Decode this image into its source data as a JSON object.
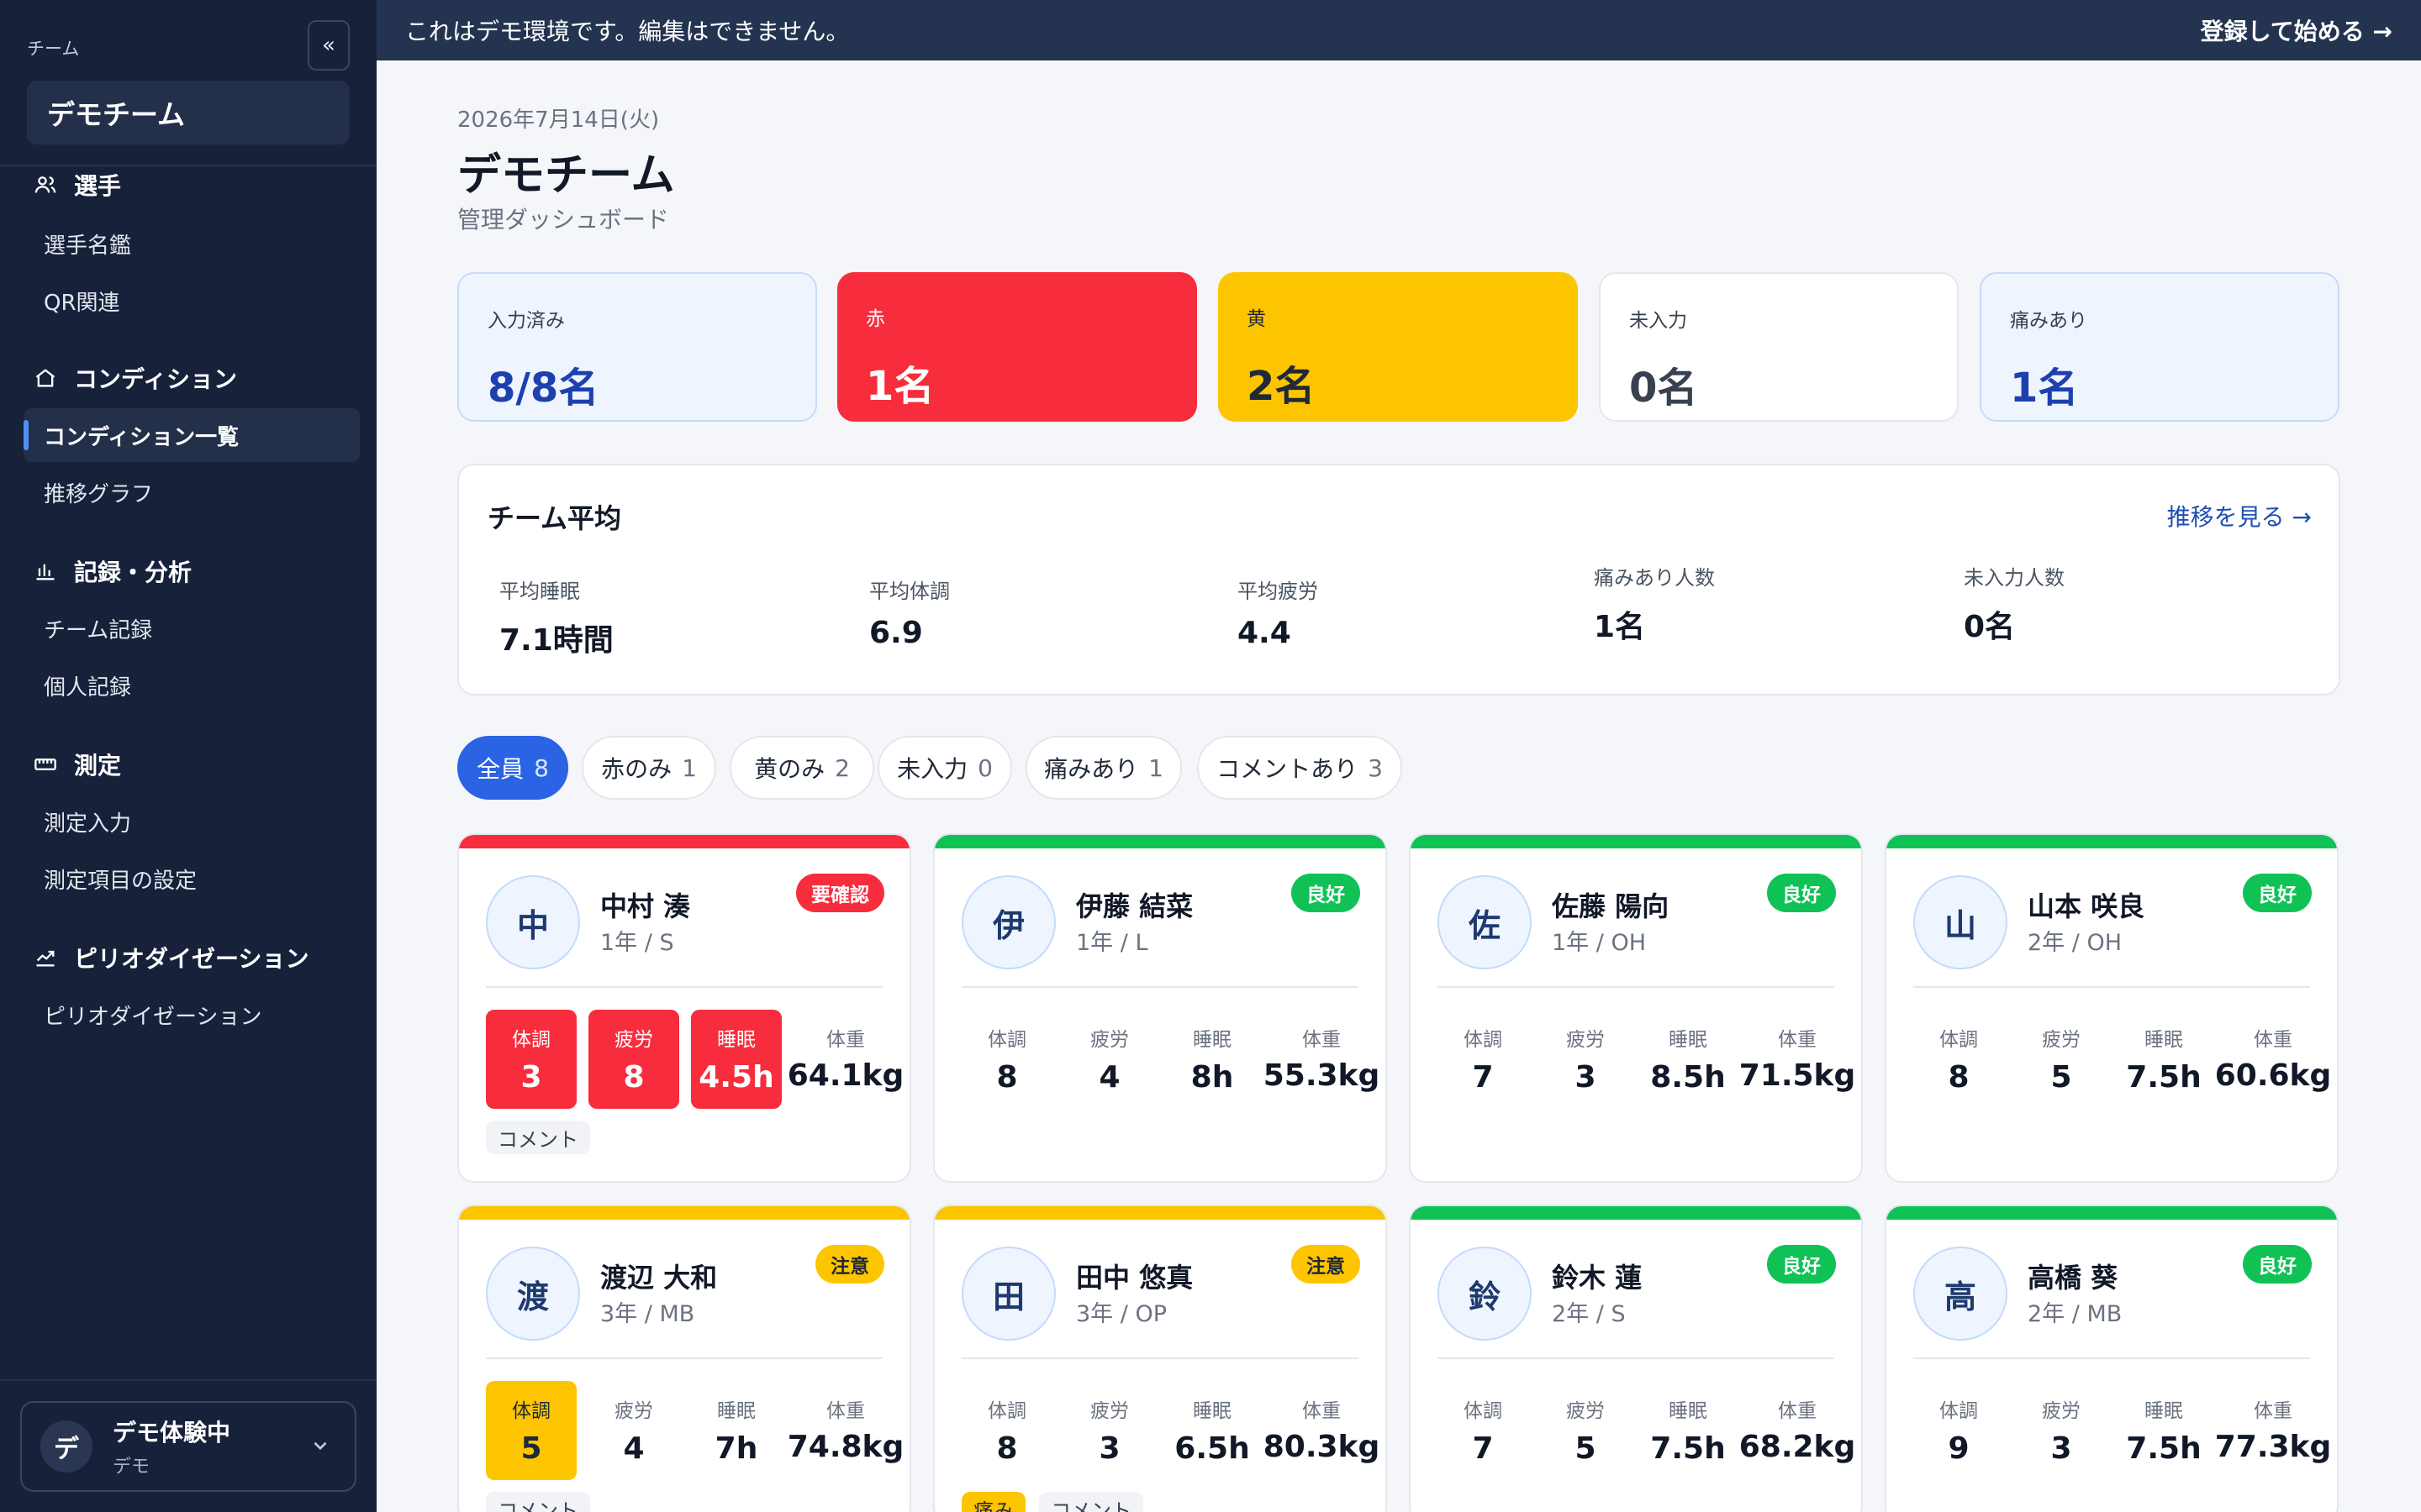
{
  "sidebar": {
    "team_caption": "チーム",
    "team_name": "デモチーム",
    "collapse_label": "«",
    "sections": [
      {
        "label": "選手",
        "icon": "users-icon",
        "items": [
          {
            "label": "選手名鑑",
            "active": false
          },
          {
            "label": "QR関連",
            "active": false
          }
        ]
      },
      {
        "label": "コンディション",
        "icon": "home-icon",
        "items": [
          {
            "label": "コンディション一覧",
            "active": true
          },
          {
            "label": "推移グラフ",
            "active": false
          }
        ]
      },
      {
        "label": "記録・分析",
        "icon": "bar-chart-icon",
        "items": [
          {
            "label": "チーム記録",
            "active": false
          },
          {
            "label": "個人記録",
            "active": false
          }
        ]
      },
      {
        "label": "測定",
        "icon": "ruler-icon",
        "items": [
          {
            "label": "測定入力",
            "active": false
          },
          {
            "label": "測定項目の設定",
            "active": false
          }
        ]
      },
      {
        "label": "ピリオダイゼーション",
        "icon": "trend-icon",
        "items": [
          {
            "label": "ピリオダイゼーション",
            "active": false
          }
        ]
      }
    ],
    "user": {
      "avatar": "デ",
      "name": "デモ体験中",
      "sub": "デモ"
    }
  },
  "banner": {
    "message": "これはデモ環境です。編集はできません。",
    "cta": "登録して始める →"
  },
  "header": {
    "date": "2026年7月14日(火)",
    "title": "デモチーム",
    "subtitle": "管理ダッシュボード"
  },
  "stats": [
    {
      "label": "入力済み",
      "value": "8/8名",
      "style": "blue"
    },
    {
      "label": "赤",
      "value": "1名",
      "style": "red"
    },
    {
      "label": "黄",
      "value": "2名",
      "style": "yellow"
    },
    {
      "label": "未入力",
      "value": "0名",
      "style": "white"
    },
    {
      "label": "痛みあり",
      "value": "1名",
      "style": "blue"
    }
  ],
  "team_average": {
    "title": "チーム平均",
    "link": "推移を見る →",
    "metrics": [
      {
        "label": "平均睡眠",
        "value": "7.1時間"
      },
      {
        "label": "平均体調",
        "value": "6.9"
      },
      {
        "label": "平均疲労",
        "value": "4.4"
      },
      {
        "label": "痛みあり人数",
        "value": "1名"
      },
      {
        "label": "未入力人数",
        "value": "0名"
      }
    ]
  },
  "filters": [
    {
      "label": "全員",
      "count": "8",
      "active": true
    },
    {
      "label": "赤のみ",
      "count": "1",
      "active": false
    },
    {
      "label": "黄のみ",
      "count": "2",
      "active": false
    },
    {
      "label": "未入力",
      "count": "0",
      "active": false
    },
    {
      "label": "痛みあり",
      "count": "1",
      "active": false
    },
    {
      "label": "コメントあり",
      "count": "3",
      "active": false
    }
  ],
  "colors": {
    "red": "#f72c3c",
    "yellow": "#fdc500",
    "green": "#10c255",
    "accent": "#2a63e3"
  },
  "metric_labels": {
    "condition": "体調",
    "fatigue": "疲労",
    "sleep": "睡眠",
    "weight": "体重"
  },
  "players": [
    {
      "initial": "中",
      "name": "中村 湊",
      "meta": "1年 / S",
      "status": "要確認",
      "status_color": "red",
      "condition": "3",
      "fatigue": "8",
      "sleep": "4.5h",
      "weight": "64.1kg",
      "highlight": {
        "condition": "red",
        "fatigue": "red",
        "sleep": "red"
      },
      "tags": [
        "コメント"
      ]
    },
    {
      "initial": "伊",
      "name": "伊藤 結菜",
      "meta": "1年 / L",
      "status": "良好",
      "status_color": "green",
      "condition": "8",
      "fatigue": "4",
      "sleep": "8h",
      "weight": "55.3kg",
      "highlight": {},
      "tags": []
    },
    {
      "initial": "佐",
      "name": "佐藤 陽向",
      "meta": "1年 / OH",
      "status": "良好",
      "status_color": "green",
      "condition": "7",
      "fatigue": "3",
      "sleep": "8.5h",
      "weight": "71.5kg",
      "highlight": {},
      "tags": []
    },
    {
      "initial": "山",
      "name": "山本 咲良",
      "meta": "2年 / OH",
      "status": "良好",
      "status_color": "green",
      "condition": "8",
      "fatigue": "5",
      "sleep": "7.5h",
      "weight": "60.6kg",
      "highlight": {},
      "tags": []
    },
    {
      "initial": "渡",
      "name": "渡辺 大和",
      "meta": "3年 / MB",
      "status": "注意",
      "status_color": "yellow",
      "condition": "5",
      "fatigue": "4",
      "sleep": "7h",
      "weight": "74.8kg",
      "highlight": {
        "condition": "yellow"
      },
      "tags": [
        "コメント"
      ]
    },
    {
      "initial": "田",
      "name": "田中 悠真",
      "meta": "3年 / OP",
      "status": "注意",
      "status_color": "yellow",
      "condition": "8",
      "fatigue": "3",
      "sleep": "6.5h",
      "weight": "80.3kg",
      "highlight": {},
      "tags": [
        "痛み",
        "コメント"
      ]
    },
    {
      "initial": "鈴",
      "name": "鈴木 蓮",
      "meta": "2年 / S",
      "status": "良好",
      "status_color": "green",
      "condition": "7",
      "fatigue": "5",
      "sleep": "7.5h",
      "weight": "68.2kg",
      "highlight": {},
      "tags": []
    },
    {
      "initial": "高",
      "name": "高橋 葵",
      "meta": "2年 / MB",
      "status": "良好",
      "status_color": "green",
      "condition": "9",
      "fatigue": "3",
      "sleep": "7.5h",
      "weight": "77.3kg",
      "highlight": {},
      "tags": []
    }
  ]
}
